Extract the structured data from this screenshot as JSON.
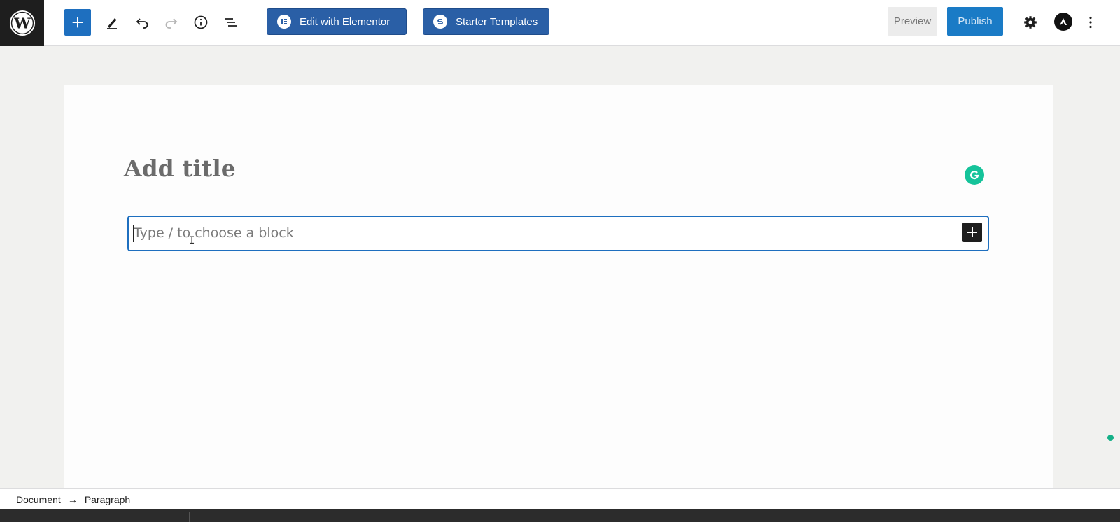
{
  "toolbar": {
    "logo_icon": "wordpress-logo-icon",
    "inserter_icon": "plus-icon",
    "tools_icon": "pencil-icon",
    "undo_icon": "undo-icon",
    "redo_icon": "redo-icon",
    "info_icon": "info-icon",
    "list_view_icon": "list-view-icon",
    "edit_elementor_label": "Edit with Elementor",
    "starter_templates_label": "Starter Templates",
    "preview_label": "Preview",
    "publish_label": "Publish",
    "settings_icon": "gear-icon",
    "astra_icon": "astra-icon",
    "more_icon": "more-vertical-icon"
  },
  "editor": {
    "title_placeholder": "Add title",
    "block_placeholder": "Type / to choose a block",
    "add_block_icon": "plus-icon",
    "grammarly_icon": "grammarly-icon"
  },
  "breadcrumb": {
    "items": [
      "Document",
      "Paragraph"
    ],
    "separator": "→"
  },
  "colors": {
    "accent": "#1e6fbf",
    "elementor_blue": "#2a5fa6",
    "publish_blue": "#1a7bc6",
    "grammarly_green": "#15c39a"
  }
}
